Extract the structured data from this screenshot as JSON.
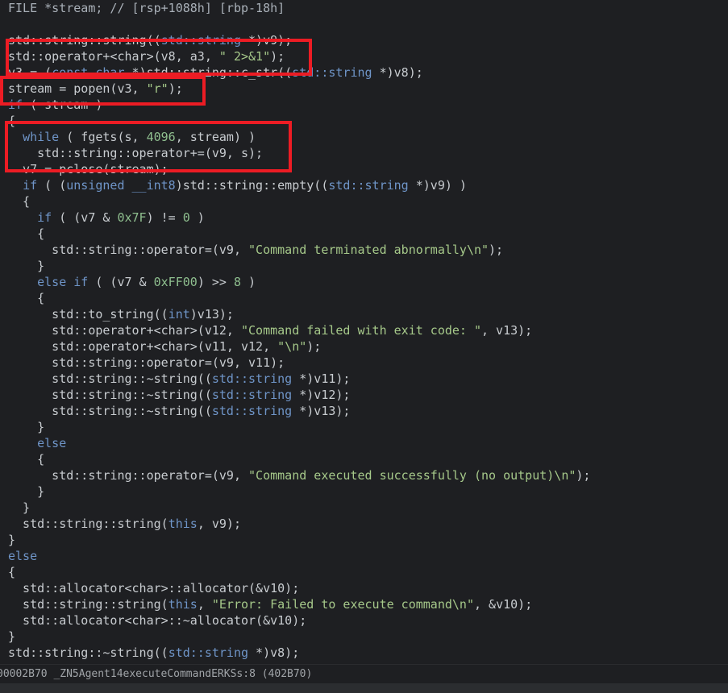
{
  "code_view": {
    "lines": [
      [
        {
          "t": "FILE *stream; // [rsp+1088h] [rbp-18h]",
          "c": "t-cmt"
        }
      ],
      [],
      [
        {
          "t": "std::string::string((",
          "c": "t-plain"
        },
        {
          "t": "std::string",
          "c": "t-type"
        },
        {
          "t": " *)v9);",
          "c": "t-plain"
        }
      ],
      [
        {
          "t": "std::operator+<char>(v8, a3, ",
          "c": "t-plain"
        },
        {
          "t": "\" 2>&1\"",
          "c": "t-str"
        },
        {
          "t": ");",
          "c": "t-plain"
        }
      ],
      [
        {
          "t": "v3 = (",
          "c": "t-plain"
        },
        {
          "t": "const char",
          "c": "t-kw"
        },
        {
          "t": " *)std::string::c_str((",
          "c": "t-plain"
        },
        {
          "t": "std::string",
          "c": "t-type"
        },
        {
          "t": " *)v8);",
          "c": "t-plain"
        }
      ],
      [
        {
          "t": "stream = popen(v3, ",
          "c": "t-plain"
        },
        {
          "t": "\"r\"",
          "c": "t-str"
        },
        {
          "t": ");",
          "c": "t-plain"
        }
      ],
      [
        {
          "t": "if",
          "c": "t-kw"
        },
        {
          "t": " ( stream )",
          "c": "t-plain"
        }
      ],
      [
        {
          "t": "{",
          "c": "t-plain"
        }
      ],
      [
        {
          "t": "  ",
          "c": "t-plain"
        },
        {
          "t": "while",
          "c": "t-kw"
        },
        {
          "t": " ( fgets(s, ",
          "c": "t-plain"
        },
        {
          "t": "4096",
          "c": "t-num"
        },
        {
          "t": ", stream) )",
          "c": "t-plain"
        }
      ],
      [
        {
          "t": "    std::string::operator+=(v9, s);",
          "c": "t-plain"
        }
      ],
      [
        {
          "t": "  v7 = pclose(stream);",
          "c": "t-plain"
        }
      ],
      [
        {
          "t": "  ",
          "c": "t-plain"
        },
        {
          "t": "if",
          "c": "t-kw"
        },
        {
          "t": " ( (",
          "c": "t-plain"
        },
        {
          "t": "unsigned __int8",
          "c": "t-kw"
        },
        {
          "t": ")std::string::empty((",
          "c": "t-plain"
        },
        {
          "t": "std::string",
          "c": "t-type"
        },
        {
          "t": " *)v9) )",
          "c": "t-plain"
        }
      ],
      [
        {
          "t": "  {",
          "c": "t-plain"
        }
      ],
      [
        {
          "t": "    ",
          "c": "t-plain"
        },
        {
          "t": "if",
          "c": "t-kw"
        },
        {
          "t": " ( (v7 & ",
          "c": "t-plain"
        },
        {
          "t": "0x7F",
          "c": "t-num"
        },
        {
          "t": ") != ",
          "c": "t-plain"
        },
        {
          "t": "0",
          "c": "t-num"
        },
        {
          "t": " )",
          "c": "t-plain"
        }
      ],
      [
        {
          "t": "    {",
          "c": "t-plain"
        }
      ],
      [
        {
          "t": "      std::string::operator=(v9, ",
          "c": "t-plain"
        },
        {
          "t": "\"Command terminated abnormally\\n\"",
          "c": "t-str"
        },
        {
          "t": ");",
          "c": "t-plain"
        }
      ],
      [
        {
          "t": "    }",
          "c": "t-plain"
        }
      ],
      [
        {
          "t": "    ",
          "c": "t-plain"
        },
        {
          "t": "else if",
          "c": "t-kw"
        },
        {
          "t": " ( (v7 & ",
          "c": "t-plain"
        },
        {
          "t": "0xFF00",
          "c": "t-num"
        },
        {
          "t": ") >> ",
          "c": "t-plain"
        },
        {
          "t": "8",
          "c": "t-num"
        },
        {
          "t": " )",
          "c": "t-plain"
        }
      ],
      [
        {
          "t": "    {",
          "c": "t-plain"
        }
      ],
      [
        {
          "t": "      std::to_string((",
          "c": "t-plain"
        },
        {
          "t": "int",
          "c": "t-kw"
        },
        {
          "t": ")v13);",
          "c": "t-plain"
        }
      ],
      [
        {
          "t": "      std::operator+<char>(v12, ",
          "c": "t-plain"
        },
        {
          "t": "\"Command failed with exit code: \"",
          "c": "t-str"
        },
        {
          "t": ", v13);",
          "c": "t-plain"
        }
      ],
      [
        {
          "t": "      std::operator+<char>(v11, v12, ",
          "c": "t-plain"
        },
        {
          "t": "\"\\n\"",
          "c": "t-str"
        },
        {
          "t": ");",
          "c": "t-plain"
        }
      ],
      [
        {
          "t": "      std::string::operator=(v9, v11);",
          "c": "t-plain"
        }
      ],
      [
        {
          "t": "      std::string::~string((",
          "c": "t-plain"
        },
        {
          "t": "std::string",
          "c": "t-type"
        },
        {
          "t": " *)v11);",
          "c": "t-plain"
        }
      ],
      [
        {
          "t": "      std::string::~string((",
          "c": "t-plain"
        },
        {
          "t": "std::string",
          "c": "t-type"
        },
        {
          "t": " *)v12);",
          "c": "t-plain"
        }
      ],
      [
        {
          "t": "      std::string::~string((",
          "c": "t-plain"
        },
        {
          "t": "std::string",
          "c": "t-type"
        },
        {
          "t": " *)v13);",
          "c": "t-plain"
        }
      ],
      [
        {
          "t": "    }",
          "c": "t-plain"
        }
      ],
      [
        {
          "t": "    ",
          "c": "t-plain"
        },
        {
          "t": "else",
          "c": "t-kw"
        }
      ],
      [
        {
          "t": "    {",
          "c": "t-plain"
        }
      ],
      [
        {
          "t": "      std::string::operator=(v9, ",
          "c": "t-plain"
        },
        {
          "t": "\"Command executed successfully (no output)\\n\"",
          "c": "t-str"
        },
        {
          "t": ");",
          "c": "t-plain"
        }
      ],
      [
        {
          "t": "    }",
          "c": "t-plain"
        }
      ],
      [
        {
          "t": "  }",
          "c": "t-plain"
        }
      ],
      [
        {
          "t": "  std::string::string(",
          "c": "t-plain"
        },
        {
          "t": "this",
          "c": "t-kw"
        },
        {
          "t": ", v9);",
          "c": "t-plain"
        }
      ],
      [
        {
          "t": "}",
          "c": "t-plain"
        }
      ],
      [
        {
          "t": "else",
          "c": "t-kw"
        }
      ],
      [
        {
          "t": "{",
          "c": "t-plain"
        }
      ],
      [
        {
          "t": "  std::allocator<char>::allocator(&v10);",
          "c": "t-plain"
        }
      ],
      [
        {
          "t": "  std::string::string(",
          "c": "t-plain"
        },
        {
          "t": "this",
          "c": "t-kw"
        },
        {
          "t": ", ",
          "c": "t-plain"
        },
        {
          "t": "\"Error: Failed to execute command\\n\"",
          "c": "t-str"
        },
        {
          "t": ", &v10);",
          "c": "t-plain"
        }
      ],
      [
        {
          "t": "  std::allocator<char>::~allocator(&v10);",
          "c": "t-plain"
        }
      ],
      [
        {
          "t": "}",
          "c": "t-plain"
        }
      ],
      [
        {
          "t": "std::string::~string((",
          "c": "t-plain"
        },
        {
          "t": "std::string",
          "c": "t-type"
        },
        {
          "t": " *)v8);",
          "c": "t-plain"
        }
      ],
      [
        {
          "t": "std::string::~string((",
          "c": "t-plain"
        },
        {
          "t": "std::string",
          "c": "t-type"
        },
        {
          "t": " *)v9);",
          "c": "t-plain"
        }
      ]
    ]
  },
  "status_bar": {
    "text": "00002B70 _ZN5Agent14executeCommandERKSs:8 (402B70)"
  },
  "colors": {
    "background": "#1e1f22",
    "highlight_box": "#ec1c24"
  }
}
